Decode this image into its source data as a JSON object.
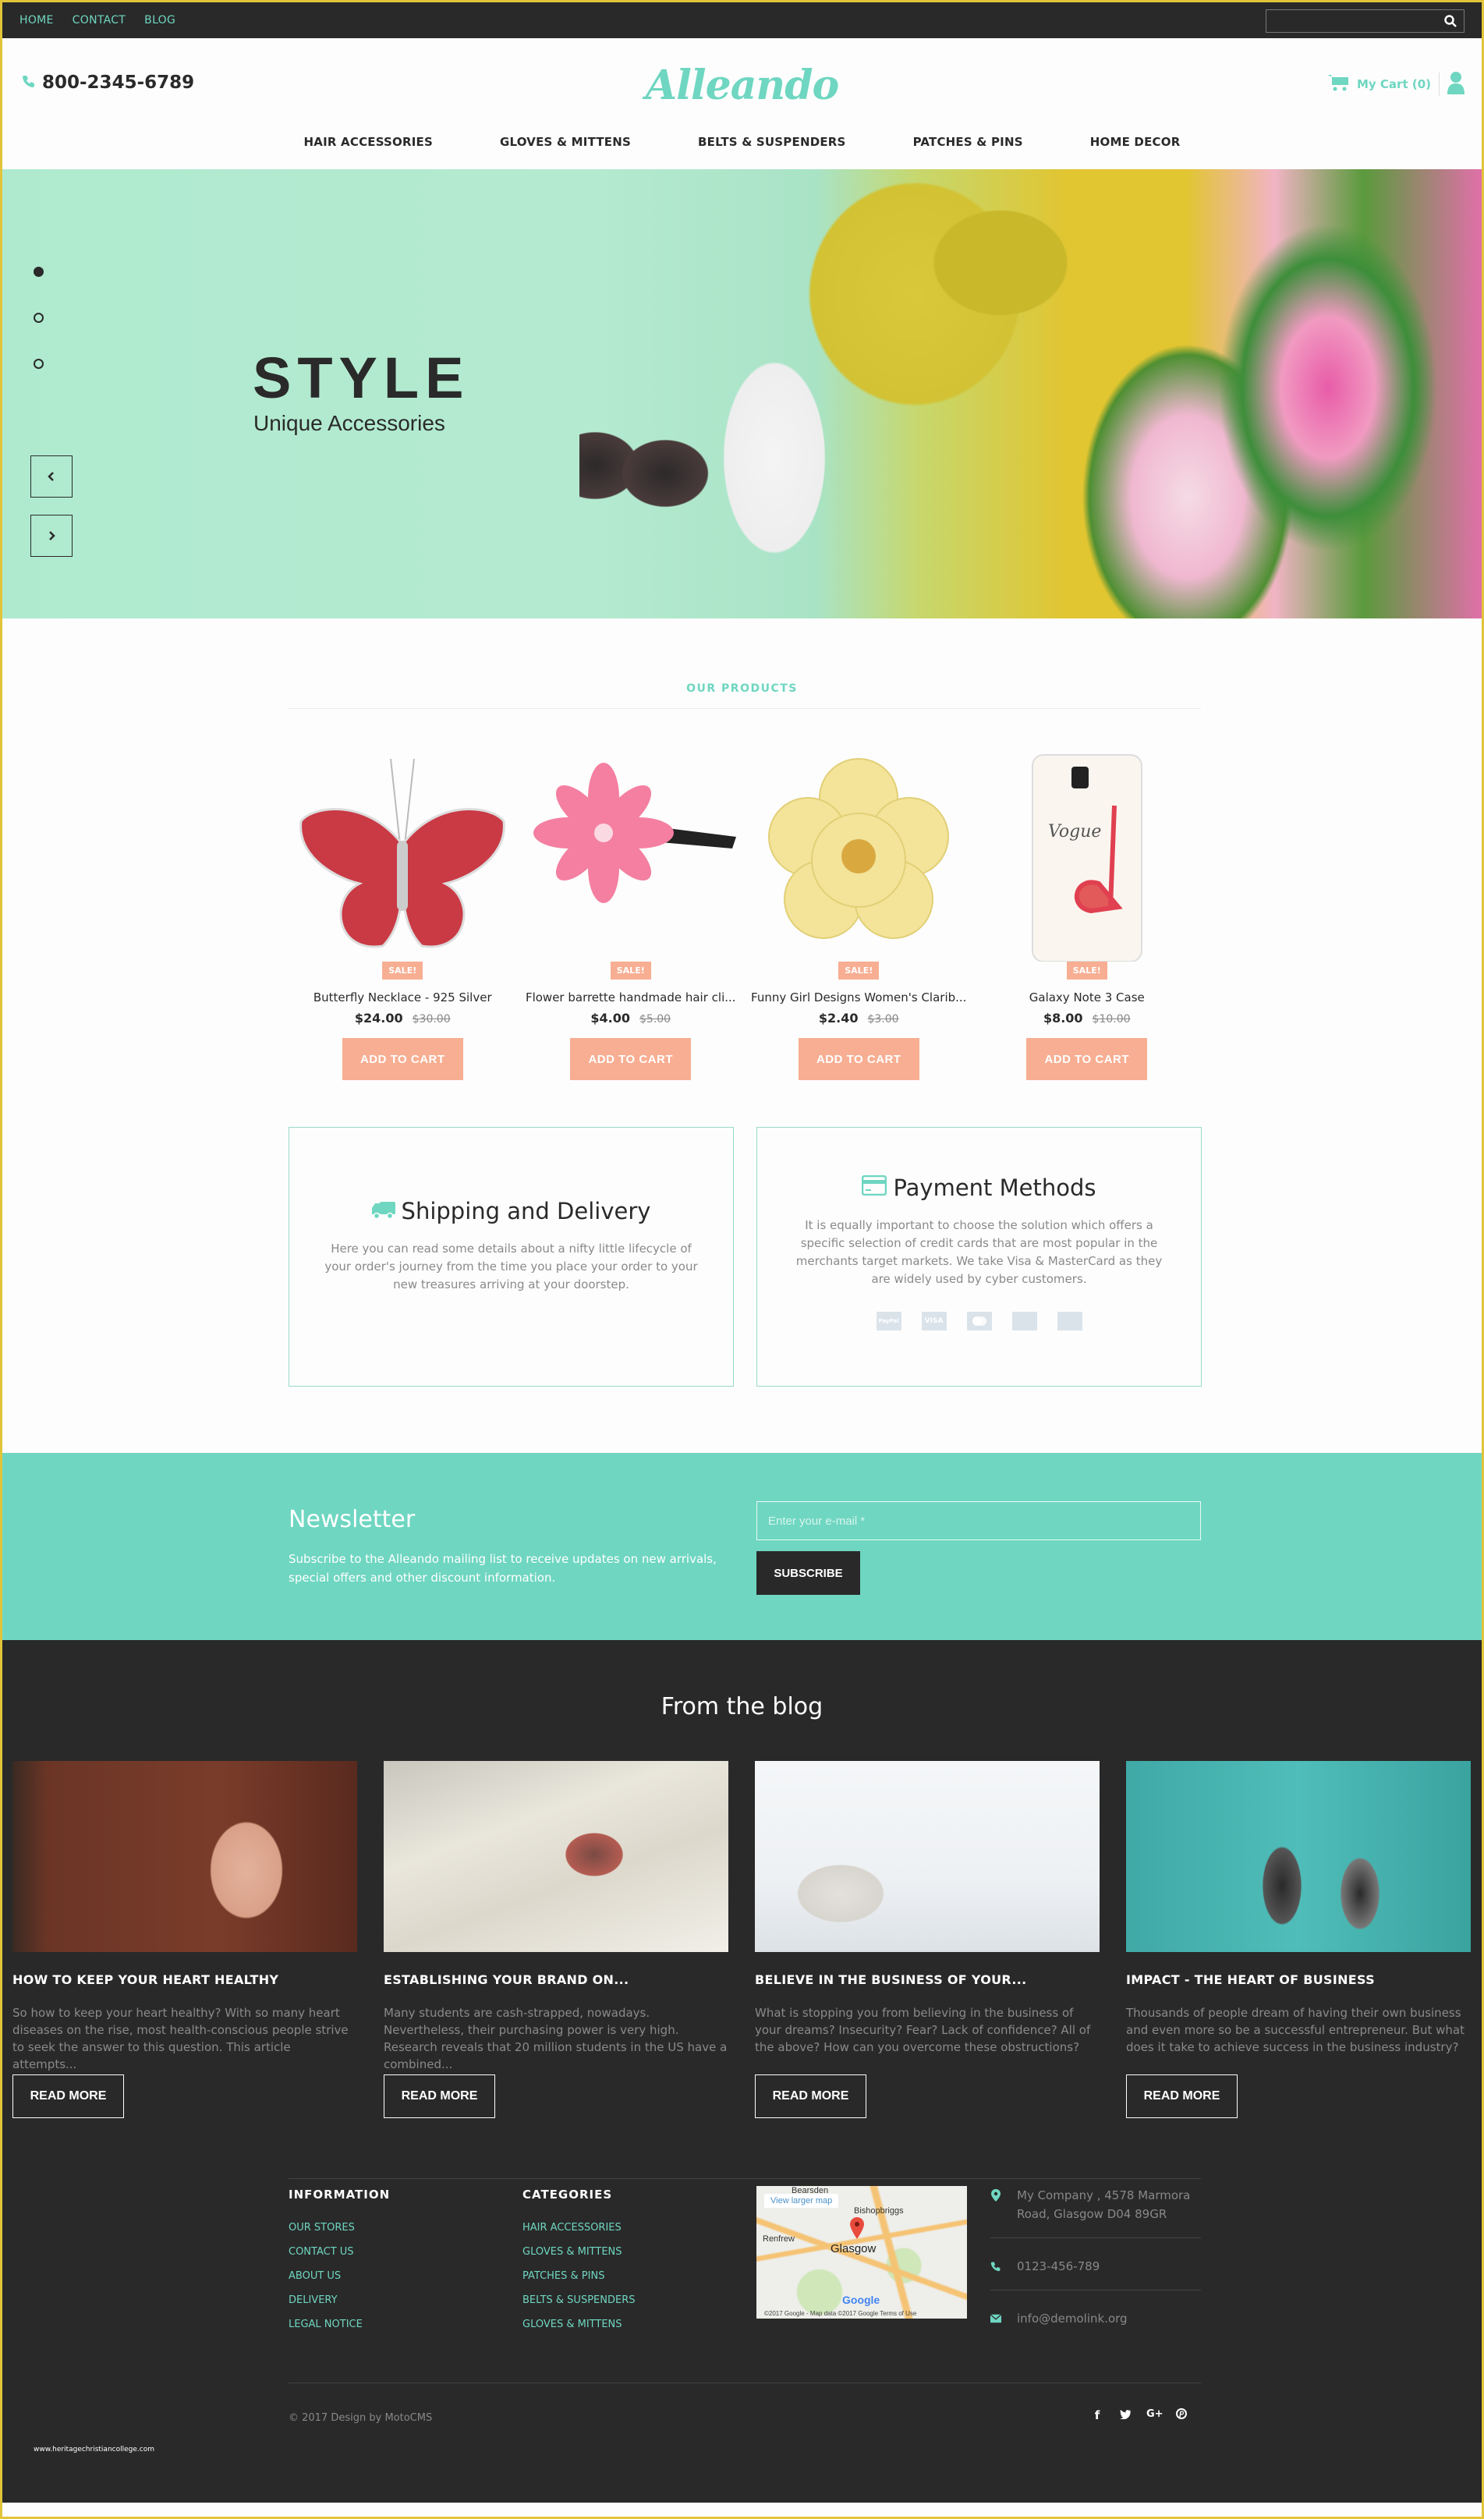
{
  "topbar": {
    "nav": [
      "HOME",
      "CONTACT",
      "BLOG"
    ],
    "search_placeholder": "",
    "search_icon": "search-icon"
  },
  "header": {
    "phone": "800-2345-6789",
    "logo": "Alleando",
    "cart_label": "My Cart (0)",
    "menu": [
      "HAIR ACCESSORIES",
      "GLOVES & MITTENS",
      "BELTS & SUSPENDERS",
      "PATCHES & PINS",
      "HOME DECOR"
    ]
  },
  "hero": {
    "title": "STYLE",
    "subtitle": "Unique Accessories",
    "slides": 3,
    "active_slide": 1
  },
  "products": {
    "section_title": "OUR PRODUCTS",
    "items": [
      {
        "name": "Butterfly Necklace - 925 Silver",
        "price": "$24.00",
        "old_price": "$30.00",
        "badge": "SALE!",
        "button": "ADD TO CART"
      },
      {
        "name": "Flower barrette handmade hair cli...",
        "price": "$4.00",
        "old_price": "$5.00",
        "badge": "SALE!",
        "button": "ADD TO CART"
      },
      {
        "name": "Funny Girl Designs Women's Clarib...",
        "price": "$2.40",
        "old_price": "$3.00",
        "badge": "SALE!",
        "button": "ADD TO CART"
      },
      {
        "name": "Galaxy Note 3 Case",
        "price": "$8.00",
        "old_price": "$10.00",
        "badge": "SALE!",
        "button": "ADD TO CART"
      }
    ]
  },
  "info": {
    "shipping": {
      "title": "Shipping and Delivery",
      "text": "Here you can read some details about a nifty little lifecycle of your order's journey from the time you place your order to your new treasures arriving at your doorstep."
    },
    "payment": {
      "title": "Payment Methods",
      "text": "It is equally important to choose the solution which offers a specific selection of credit cards that are most popular in the merchants target markets. We take Visa & MasterCard as they are widely used by cyber customers.",
      "cards": [
        "PayPal",
        "VISA",
        "MasterCard",
        "Discover",
        "American Express"
      ]
    }
  },
  "newsletter": {
    "title": "Newsletter",
    "text": "Subscribe to the Alleando mailing list to receive updates on new arrivals, special offers and other discount information.",
    "placeholder": "Enter your e-mail *",
    "button": "SUBSCRIBE"
  },
  "blog": {
    "title": "From the blog",
    "posts": [
      {
        "title": "HOW TO KEEP YOUR HEART HEALTHY",
        "excerpt": "So how to keep your heart healthy? With so many heart diseases on the rise, most health-conscious people strive to seek the answer to this question. This article attempts...",
        "button": "READ MORE"
      },
      {
        "title": "ESTABLISHING YOUR BRAND ON...",
        "excerpt": "Many students are cash-strapped, nowadays. Nevertheless, their purchasing power is very high. Research reveals that 20 million students in the US have a combined...",
        "button": "READ MORE"
      },
      {
        "title": "BELIEVE IN THE BUSINESS OF YOUR...",
        "excerpt": "What is stopping you from believing in the business of your dreams? Insecurity? Fear? Lack of confidence? All of the above? How can you overcome these obstructions?",
        "button": "READ MORE"
      },
      {
        "title": "IMPACT - THE HEART OF BUSINESS",
        "excerpt": "Thousands of people dream of having their own business and even more so be a successful entrepreneur. But what does it take to achieve success in the business industry?",
        "button": "READ MORE"
      }
    ]
  },
  "footer": {
    "information": {
      "title": "INFORMATION",
      "links": [
        "OUR STORES",
        "CONTACT US",
        "ABOUT US",
        "DELIVERY",
        "LEGAL NOTICE"
      ]
    },
    "categories": {
      "title": "CATEGORIES",
      "links": [
        "HAIR ACCESSORIES",
        "GLOVES & MITTENS",
        "PATCHES & PINS",
        "BELTS & SUSPENDERS",
        "GLOVES & MITTENS"
      ]
    },
    "map": {
      "link": "View larger map",
      "city": "Glasgow",
      "labels": [
        "Bearsden",
        "Bishopbriggs",
        "Renfrew"
      ],
      "attribution": "©2017 Google - Map data ©2017 Google   Terms of Use",
      "brand": "Google"
    },
    "contact": {
      "address": "My Company , 4578 Marmora Road, Glasgow D04 89GR",
      "phone": "0123-456-789",
      "email": "info@demolink.org"
    },
    "copyright": "© 2017 Design by MotoCMS",
    "social": [
      "f",
      "t",
      "G+",
      "p"
    ],
    "watermark": "www.heritagechristiancollege.com"
  },
  "colors": {
    "accent": "#6fd6c1",
    "sale": "#f7ae92",
    "dark": "#292929",
    "frame": "#e2c43a"
  }
}
